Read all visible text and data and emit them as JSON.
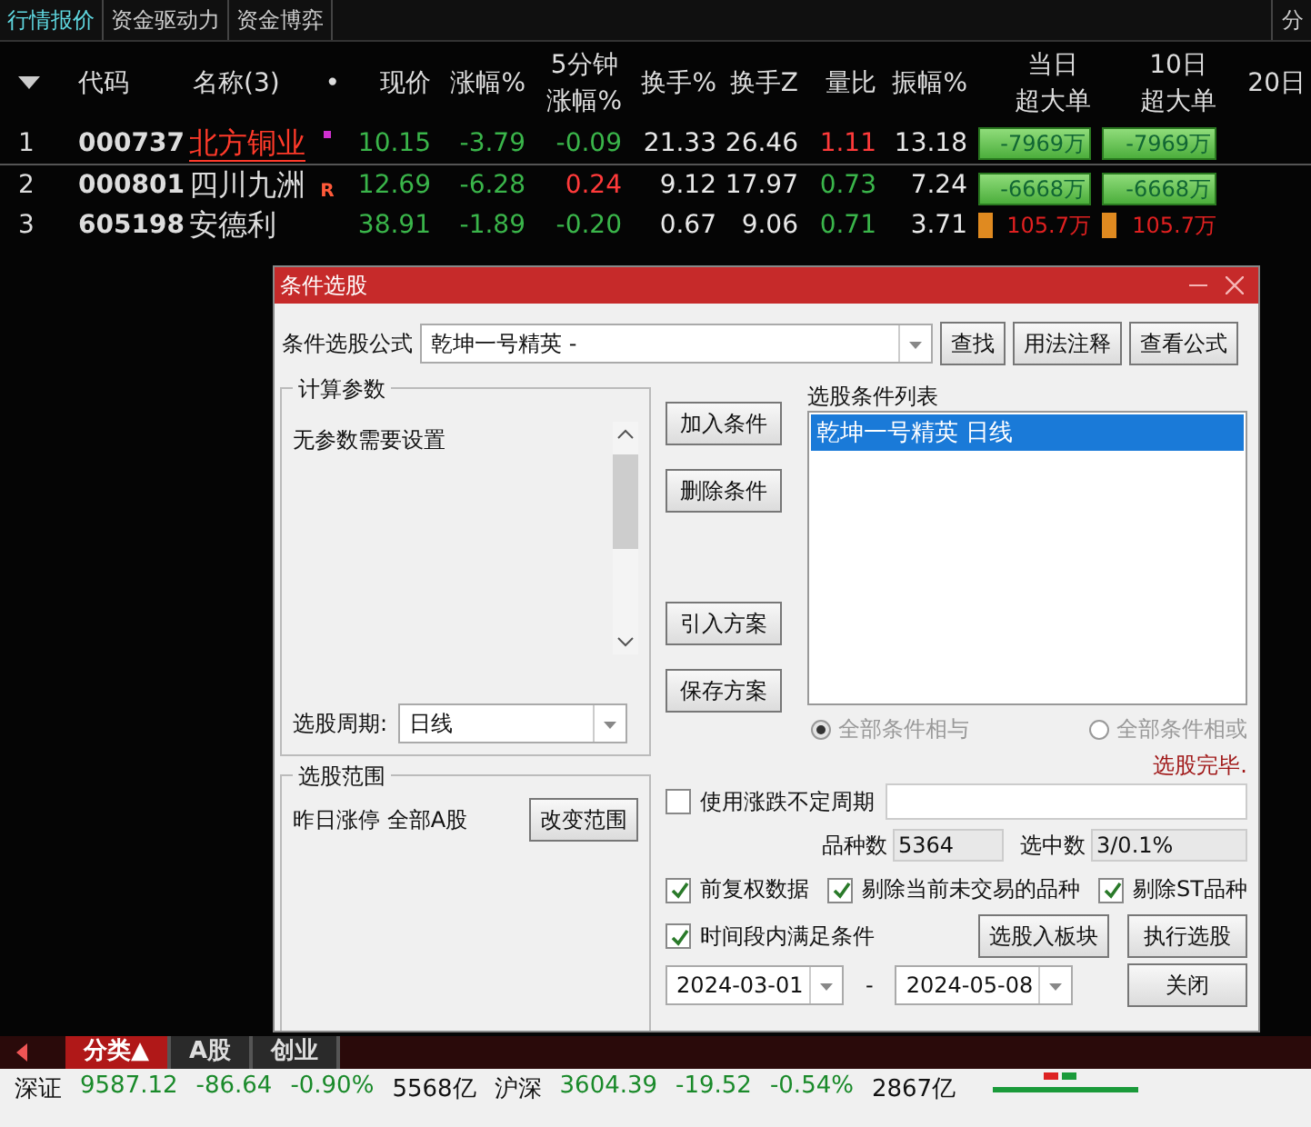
{
  "top_tabs": [
    {
      "label": "行情报价",
      "selected": true
    },
    {
      "label": "资金驱动力",
      "selected": false
    },
    {
      "label": "资金博弈",
      "selected": false
    }
  ],
  "top_right_label": "分",
  "table": {
    "columns": [
      {
        "kind": "sort"
      },
      {
        "kind": "text",
        "lines": [
          "代码"
        ]
      },
      {
        "kind": "text",
        "lines": [
          "名称(3)"
        ]
      },
      {
        "kind": "text",
        "lines": [
          "•"
        ]
      },
      {
        "kind": "text",
        "lines": [
          "现价"
        ]
      },
      {
        "kind": "text",
        "lines": [
          "涨幅%"
        ]
      },
      {
        "kind": "text",
        "lines": [
          "5分钟",
          "涨幅%"
        ]
      },
      {
        "kind": "text",
        "lines": [
          "换手%"
        ]
      },
      {
        "kind": "text",
        "lines": [
          "换手Z"
        ]
      },
      {
        "kind": "text",
        "lines": [
          "量比"
        ]
      },
      {
        "kind": "text",
        "lines": [
          "振幅%"
        ]
      },
      {
        "kind": "text",
        "lines": [
          "当日",
          "超大单"
        ]
      },
      {
        "kind": "text",
        "lines": [
          "10日",
          "超大单"
        ]
      },
      {
        "kind": "text",
        "lines": [
          "20日"
        ]
      }
    ],
    "rows": [
      {
        "index": "1",
        "code": "000737",
        "name": "北方铜业",
        "selected": true,
        "marker": {
          "kind": "dot"
        },
        "values": [
          {
            "text": "10.15",
            "color": "#3ab54a"
          },
          {
            "text": "-3.79",
            "color": "#3ab54a"
          },
          {
            "text": "-0.09",
            "color": "#3ab54a"
          },
          {
            "text": "21.33",
            "color": "#e8e8e8"
          },
          {
            "text": "26.46",
            "color": "#e8e8e8"
          },
          {
            "text": "1.11",
            "color": "#ff3a3a"
          },
          {
            "text": "13.18",
            "color": "#e8e8e8"
          }
        ],
        "orders": [
          {
            "text": "-7969万",
            "kind": "bar"
          },
          {
            "text": "-7969万",
            "kind": "bar"
          }
        ]
      },
      {
        "index": "2",
        "code": "000801",
        "name": "四川九洲",
        "selected": false,
        "marker": {
          "kind": "text",
          "text": "R"
        },
        "values": [
          {
            "text": "12.69",
            "color": "#3ab54a"
          },
          {
            "text": "-6.28",
            "color": "#3ab54a"
          },
          {
            "text": "0.24",
            "color": "#ff3a3a"
          },
          {
            "text": "9.12",
            "color": "#e8e8e8"
          },
          {
            "text": "17.97",
            "color": "#e8e8e8"
          },
          {
            "text": "0.73",
            "color": "#3ab54a"
          },
          {
            "text": "7.24",
            "color": "#e8e8e8"
          }
        ],
        "orders": [
          {
            "text": "-6668万",
            "kind": "bar"
          },
          {
            "text": "-6668万",
            "kind": "bar"
          }
        ]
      },
      {
        "index": "3",
        "code": "605198",
        "name": "安德利",
        "selected": false,
        "values": [
          {
            "text": "38.91",
            "color": "#3ab54a"
          },
          {
            "text": "-1.89",
            "color": "#3ab54a"
          },
          {
            "text": "-0.20",
            "color": "#3ab54a"
          },
          {
            "text": "0.67",
            "color": "#e8e8e8"
          },
          {
            "text": "9.06",
            "color": "#e8e8e8"
          },
          {
            "text": "0.71",
            "color": "#3ab54a"
          },
          {
            "text": "3.71",
            "color": "#e8e8e8"
          }
        ],
        "orders": [
          {
            "text": "105.7万",
            "kind": "chip"
          },
          {
            "text": "105.7万",
            "kind": "chip"
          }
        ]
      }
    ]
  },
  "dialog": {
    "title": "条件选股",
    "formula_label": "条件选股公式",
    "formula_value": "乾坤一号精英 -",
    "formula_buttons": [
      "查找",
      "用法注释",
      "查看公式"
    ],
    "params_group": {
      "title": "计算参数",
      "text": "无参数需要设置",
      "period_label": "选股周期:",
      "period_value": "日线"
    },
    "action_buttons": [
      "加入条件",
      "删除条件",
      "引入方案",
      "保存方案"
    ],
    "list_label": "选股条件列表",
    "list_items": [
      {
        "label": "乾坤一号精英  日线",
        "selected": true
      }
    ],
    "logic_disabled": true,
    "logic_options": [
      {
        "label": "全部条件相与",
        "selected": true
      },
      {
        "label": "全部条件相或",
        "selected": false
      }
    ],
    "status": "选股完毕.",
    "range_group": {
      "title": "选股范围",
      "text": "昨日涨停 全部A股",
      "button": "改变范围"
    },
    "variable_period": {
      "label": "使用涨跌不定周期",
      "checked": false
    },
    "counts": [
      {
        "label": "品种数",
        "value": "5364"
      },
      {
        "label": "选中数",
        "value": "3/0.1%"
      }
    ],
    "options": [
      {
        "label": "前复权数据",
        "checked": true
      },
      {
        "label": "剔除当前未交易的品种",
        "checked": true
      },
      {
        "label": "剔除ST品种",
        "checked": true
      }
    ],
    "time_option": {
      "label": "时间段内满足条件",
      "checked": true
    },
    "block_button": "选股入板块",
    "run_button": "执行选股",
    "date_from": "2024-03-01",
    "date_sep": "-",
    "date_to": "2024-05-08",
    "close_button": "关闭"
  },
  "bottom_tabs": [
    {
      "label": "分类▲",
      "selected": true
    },
    {
      "label": "A股",
      "selected": false
    },
    {
      "label": "创业",
      "selected": false
    }
  ],
  "status_bar": [
    {
      "text": "深证",
      "color": "#111111"
    },
    {
      "text": "9587.12",
      "color": "#1a8a2a"
    },
    {
      "text": "-86.64",
      "color": "#1a8a2a"
    },
    {
      "text": "-0.90%",
      "color": "#1a8a2a"
    },
    {
      "text": "5568亿",
      "color": "#111111"
    },
    {
      "text": "沪深",
      "color": "#111111"
    },
    {
      "text": "3604.39",
      "color": "#1a8a2a"
    },
    {
      "text": "-19.52",
      "color": "#1a8a2a"
    },
    {
      "text": "-0.54%",
      "color": "#1a8a2a"
    },
    {
      "text": "2867亿",
      "color": "#111111"
    }
  ]
}
